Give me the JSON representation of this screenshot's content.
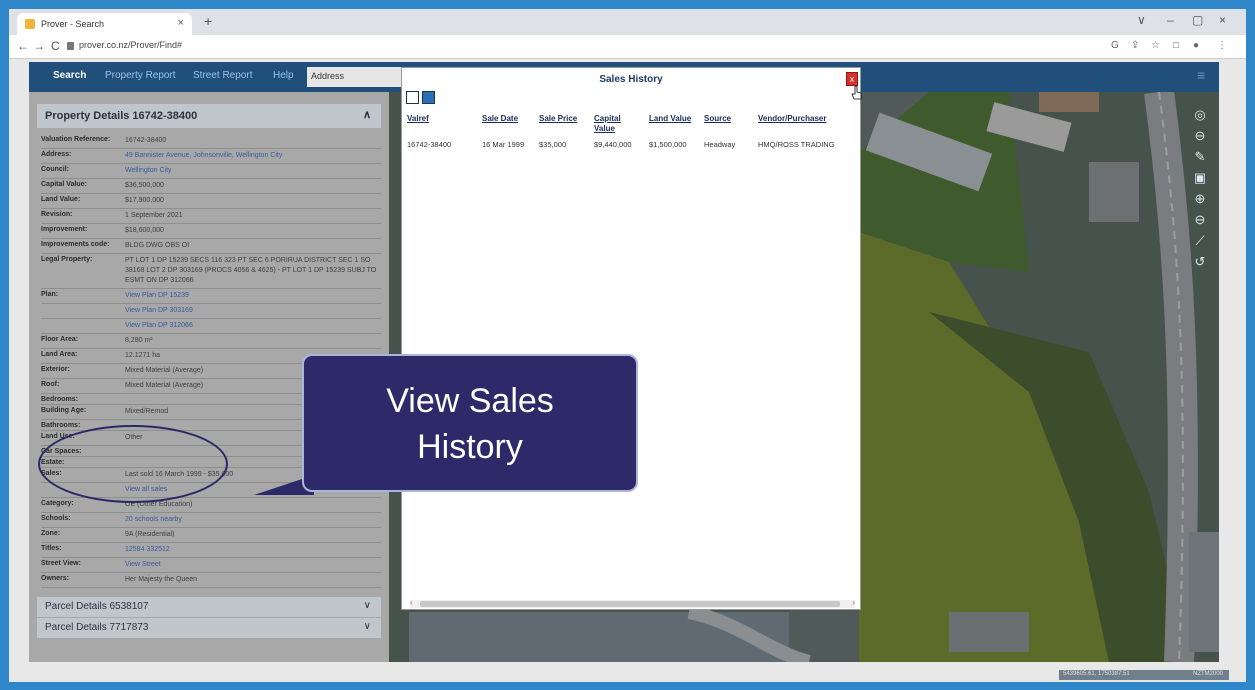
{
  "browser": {
    "tab_title": "Prover - Search",
    "tab_close": "×",
    "new_tab": "+",
    "url": "prover.co.nz/Prover/Find#",
    "back": "←",
    "forward": "→",
    "reload": "C",
    "win_min": "–",
    "win_max": "▢",
    "win_close": "×",
    "collapse": "∨",
    "toolbar": {
      "g": "G",
      "share": "⇪",
      "star": "☆",
      "ext": "□",
      "profile": "●",
      "menu": "⋮"
    }
  },
  "appnav": {
    "items": [
      "Search",
      "Property Report",
      "Street Report",
      "Help"
    ],
    "address_placeholder": "Address"
  },
  "property": {
    "title": "Property Details 16742-38400",
    "chevron": "∧",
    "rows": [
      {
        "label": "Valuation Reference:",
        "value": "16742-38400"
      },
      {
        "label": "Address:",
        "value": "49 Bannister Avenue, Johnsonville, Wellington City",
        "link": true
      },
      {
        "label": "Council:",
        "value": "Wellington City",
        "link": true
      },
      {
        "label": "Capital Value:",
        "value": "$36,500,000"
      },
      {
        "label": "Land Value:",
        "value": "$17,900,000"
      },
      {
        "label": "Revision:",
        "value": "1 September 2021"
      },
      {
        "label": "Improvement:",
        "value": "$18,600,000"
      },
      {
        "label": "Improvements code:",
        "value": "BLDG DWG OBS OI"
      },
      {
        "label": "Legal Property:",
        "value": "PT LOT 1 DP 15239 SECS 116 323 PT SEC 6 PORIRUA DISTRICT SEC 1 SO 38168 LOT 2 DP 303169 (PROCS 4056 & 4625) - PT LOT 1 DP 15239 SUBJ TO ESMT ON DP 312066"
      },
      {
        "label": "Plan:",
        "value": "View Plan DP 15239",
        "link": true
      },
      {
        "label": "",
        "value": "View Plan DP 303169",
        "link": true
      },
      {
        "label": "",
        "value": "View Plan DP 312066",
        "link": true
      },
      {
        "label": "Floor Area:",
        "value": "8,280 m²"
      },
      {
        "label": "Land Area:",
        "value": "12.1271 ha"
      },
      {
        "label": "Exterior:",
        "value": "Mixed Material (Average)"
      },
      {
        "label": "Roof:",
        "value": "Mixed Material (Average)"
      },
      {
        "label": "Bedrooms:",
        "value": ""
      },
      {
        "label": "Building Age:",
        "value": "Mixed/Remod"
      },
      {
        "label": "Bathrooms:",
        "value": ""
      },
      {
        "label": "Land Use:",
        "value": "Other"
      },
      {
        "label": "Car Spaces:",
        "value": ""
      },
      {
        "label": "Estate:",
        "value": ""
      },
      {
        "label": "Sales:",
        "value": "Last sold 16 March 1999 - $35,000"
      },
      {
        "label": "",
        "value": "View all sales",
        "link": true
      },
      {
        "label": "Category:",
        "value": "OE (Other Education)"
      },
      {
        "label": "Schools:",
        "value": "20 schools nearby",
        "link": true
      },
      {
        "label": "Zone:",
        "value": "9A (Residential)"
      },
      {
        "label": "Titles:",
        "value": "12584 332512",
        "link": true
      },
      {
        "label": "Street View:",
        "value": "View Street",
        "link": true
      },
      {
        "label": "Owners:",
        "value": "Her Majesty the Queen"
      }
    ],
    "parcels": [
      "Parcel Details 6538107",
      "Parcel Details 7717873"
    ],
    "parcel_chevron": "∨"
  },
  "dialog": {
    "title": "Sales History",
    "close": "x",
    "columns": [
      "Valref",
      "Sale Date",
      "Sale Price",
      "Capital Value",
      "Land Value",
      "Source",
      "Vendor/Purchaser"
    ],
    "row": [
      "16742-38400",
      "16 Mar 1999",
      "$35,000",
      "$9,440,000",
      "$1,500,000",
      "Headway",
      "HMQ/ROSS TRADING"
    ],
    "scroll_left": "‹",
    "scroll_right": "›"
  },
  "callout": {
    "line1": "View Sales",
    "line2": "History"
  },
  "map": {
    "status_left": "5439605.61, 1750387.51",
    "status_right": "NZTM2000"
  },
  "colors": {
    "accent": "#2e2a6a",
    "nav": "#1f4f7a",
    "close": "#d9312a"
  }
}
